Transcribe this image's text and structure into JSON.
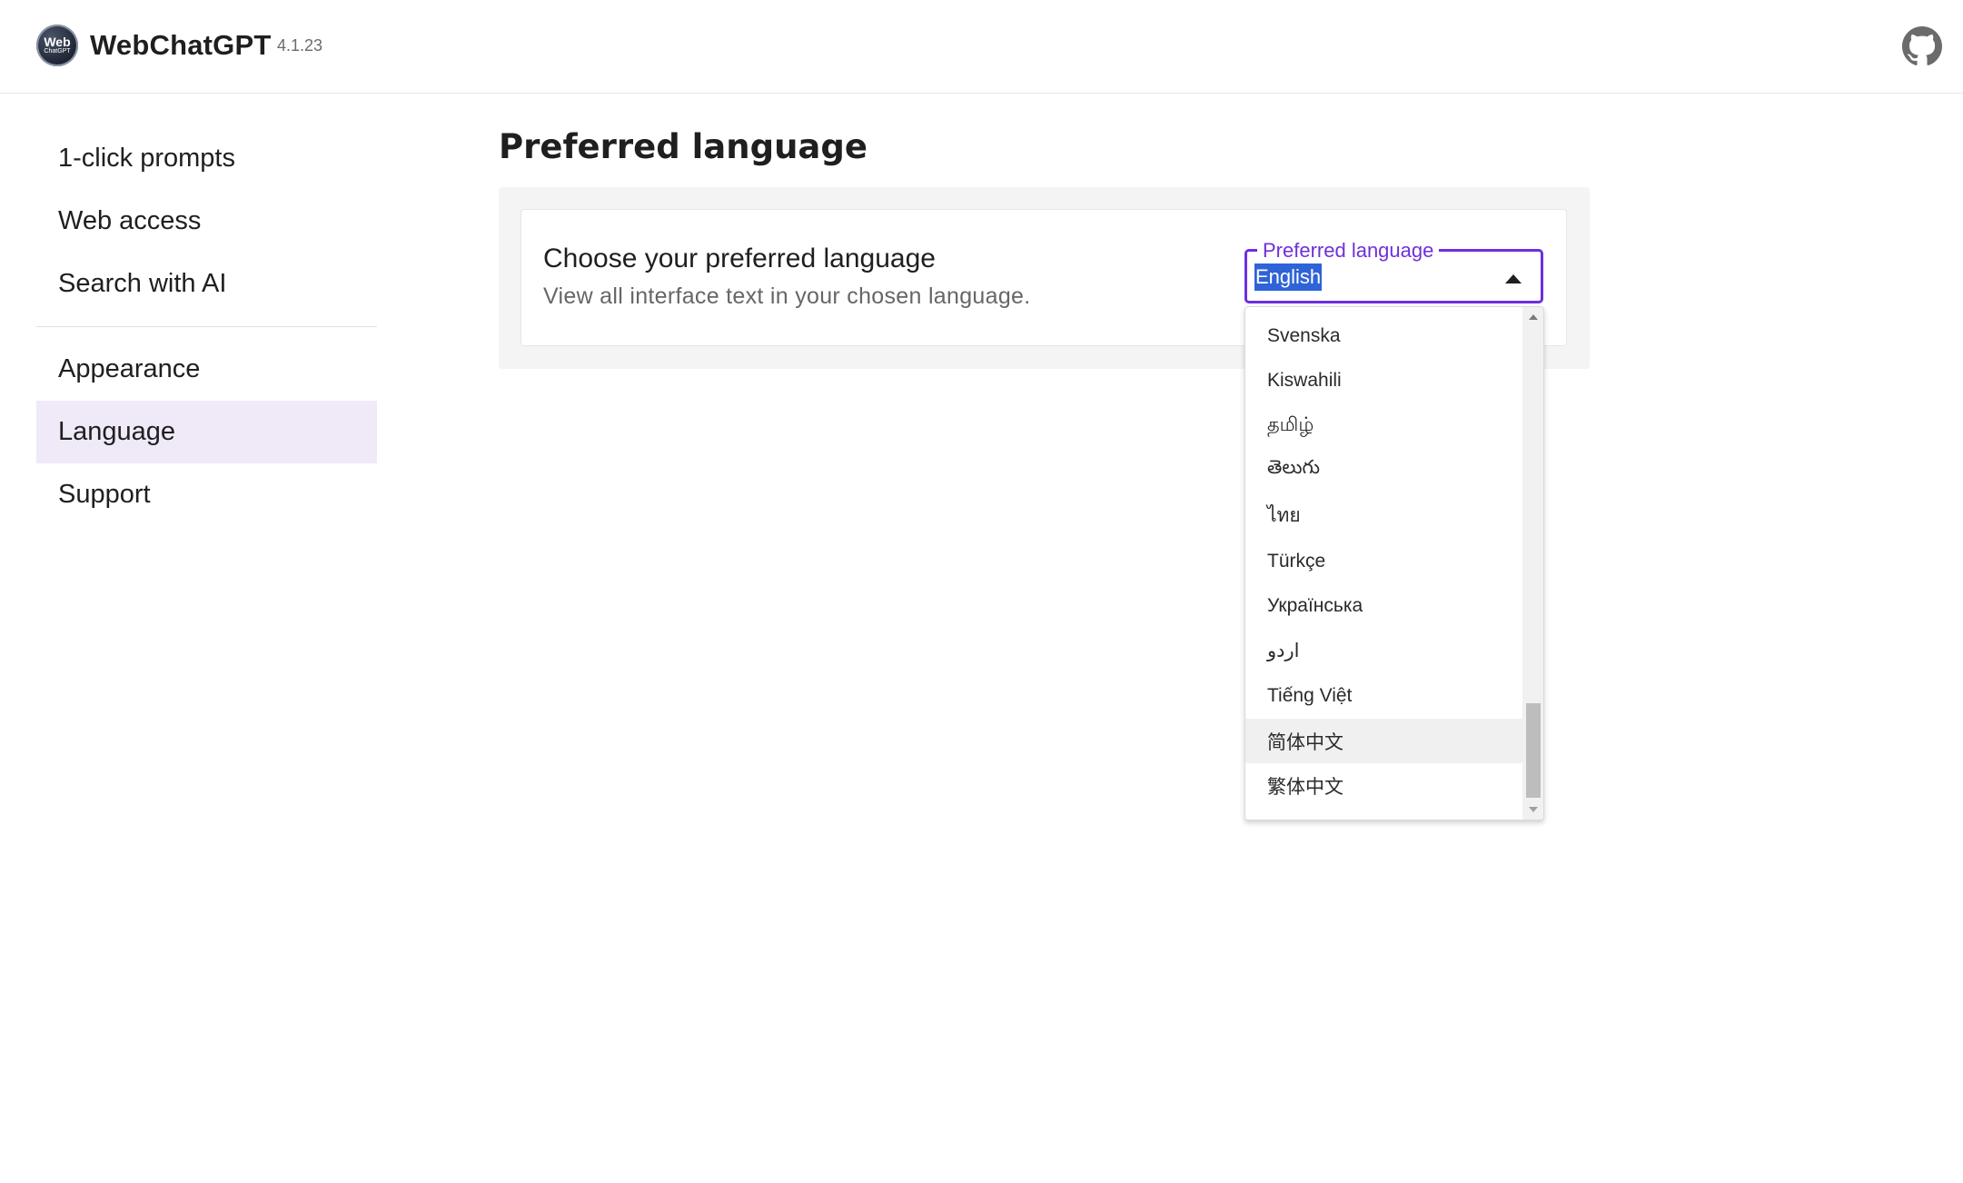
{
  "header": {
    "logo_text_main": "Web",
    "logo_text_sub": "ChatGPT",
    "app_name": "WebChatGPT",
    "version": "4.1.23",
    "github_icon": "github-icon"
  },
  "sidebar": {
    "group1": [
      {
        "label": "1-click prompts"
      },
      {
        "label": "Web access"
      },
      {
        "label": "Search with AI"
      }
    ],
    "group2": [
      {
        "label": "Appearance"
      },
      {
        "label": "Language",
        "active": true
      },
      {
        "label": "Support"
      }
    ]
  },
  "main": {
    "title": "Preferred language",
    "setting": {
      "title": "Choose your preferred language",
      "description": "View all interface text in your chosen language."
    },
    "select": {
      "label": "Preferred language",
      "value": "English",
      "options": [
        "Svenska",
        "Kiswahili",
        "தமிழ்",
        "తెలుగు",
        "ไทย",
        "Türkçe",
        "Українська",
        "اردو",
        "Tiếng Việt",
        "简体中文",
        "繁体中文"
      ],
      "hovered_option": "简体中文",
      "accent_color": "#6d2ee0",
      "highlight_color": "#2f63d7"
    }
  }
}
